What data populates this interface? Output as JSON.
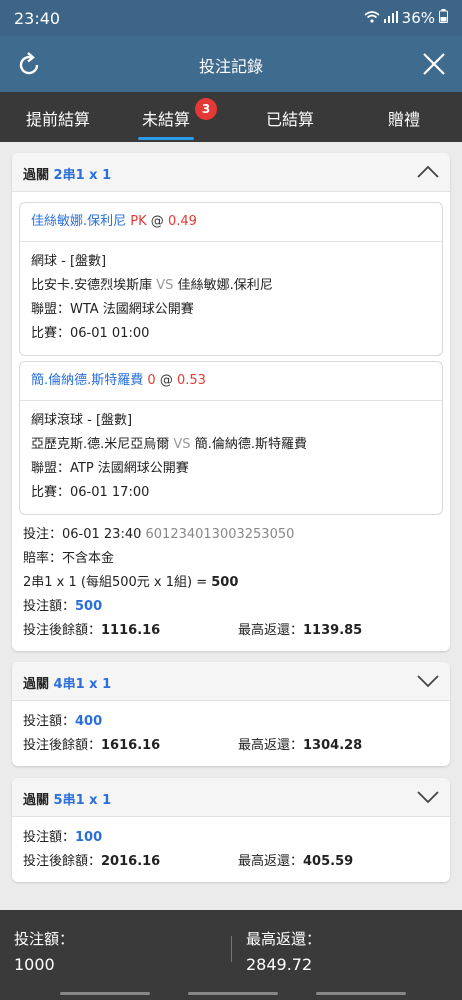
{
  "status": {
    "time": "23:40",
    "battery": "36%"
  },
  "header": {
    "title": "投注記錄"
  },
  "tabs": [
    {
      "label": "提前結算"
    },
    {
      "label": "未結算",
      "badge": "3"
    },
    {
      "label": "已結算"
    },
    {
      "label": "贈禮"
    }
  ],
  "bets": [
    {
      "label": "過關",
      "type": "2串1 x 1",
      "selections": [
        {
          "pick": "佳絲敏娜.保利尼",
          "handicap": "PK",
          "at": "@",
          "odds": "0.49",
          "market": "網球 - [盤數]",
          "home": "比安卡.安德烈埃斯庫",
          "vs": "VS",
          "away": "佳絲敏娜.保利尼",
          "league": "聯盟：WTA 法國網球公開賽",
          "match": "比賽：06-01 01:00"
        },
        {
          "pick": "簡.倫納德.斯特羅費",
          "handicap": "0",
          "at": "@",
          "odds": "0.53",
          "market": "網球滾球 - [盤數]",
          "home": "亞歷克斯.德.米尼亞烏爾",
          "vs": "VS",
          "away": "簡.倫納德.斯特羅費",
          "league": "聯盟：ATP 法國網球公開賽",
          "match": "比賽：06-01 17:00"
        }
      ],
      "bet_time_label": "投注：06-01 23:40",
      "bet_id": "601234013003253050",
      "rate": "賠率：不含本金",
      "combo": "2串1 x 1 (每組500元 x 1組) = ",
      "combo_total": "500",
      "stake_label": "投注額：",
      "stake": "500",
      "balance_label": "投注後餘額：",
      "balance": "1116.16",
      "max_label": "最高返還：",
      "max": "1139.85"
    },
    {
      "label": "過關",
      "type": "4串1 x 1",
      "stake_label": "投注額：",
      "stake": "400",
      "balance_label": "投注後餘額：",
      "balance": "1616.16",
      "max_label": "最高返還：",
      "max": "1304.28"
    },
    {
      "label": "過關",
      "type": "5串1 x 1",
      "stake_label": "投注額：",
      "stake": "100",
      "balance_label": "投注後餘額：",
      "balance": "2016.16",
      "max_label": "最高返還：",
      "max": "405.59"
    }
  ],
  "footer": {
    "stake_label": "投注額：",
    "stake": "1000",
    "max_label": "最高返還：",
    "max": "2849.72"
  },
  "colors": {
    "header": "#3f6b8e",
    "tabs": "#393939",
    "accent": "#2a6fdb",
    "odds": "#e53935",
    "badge": "#e53935"
  }
}
